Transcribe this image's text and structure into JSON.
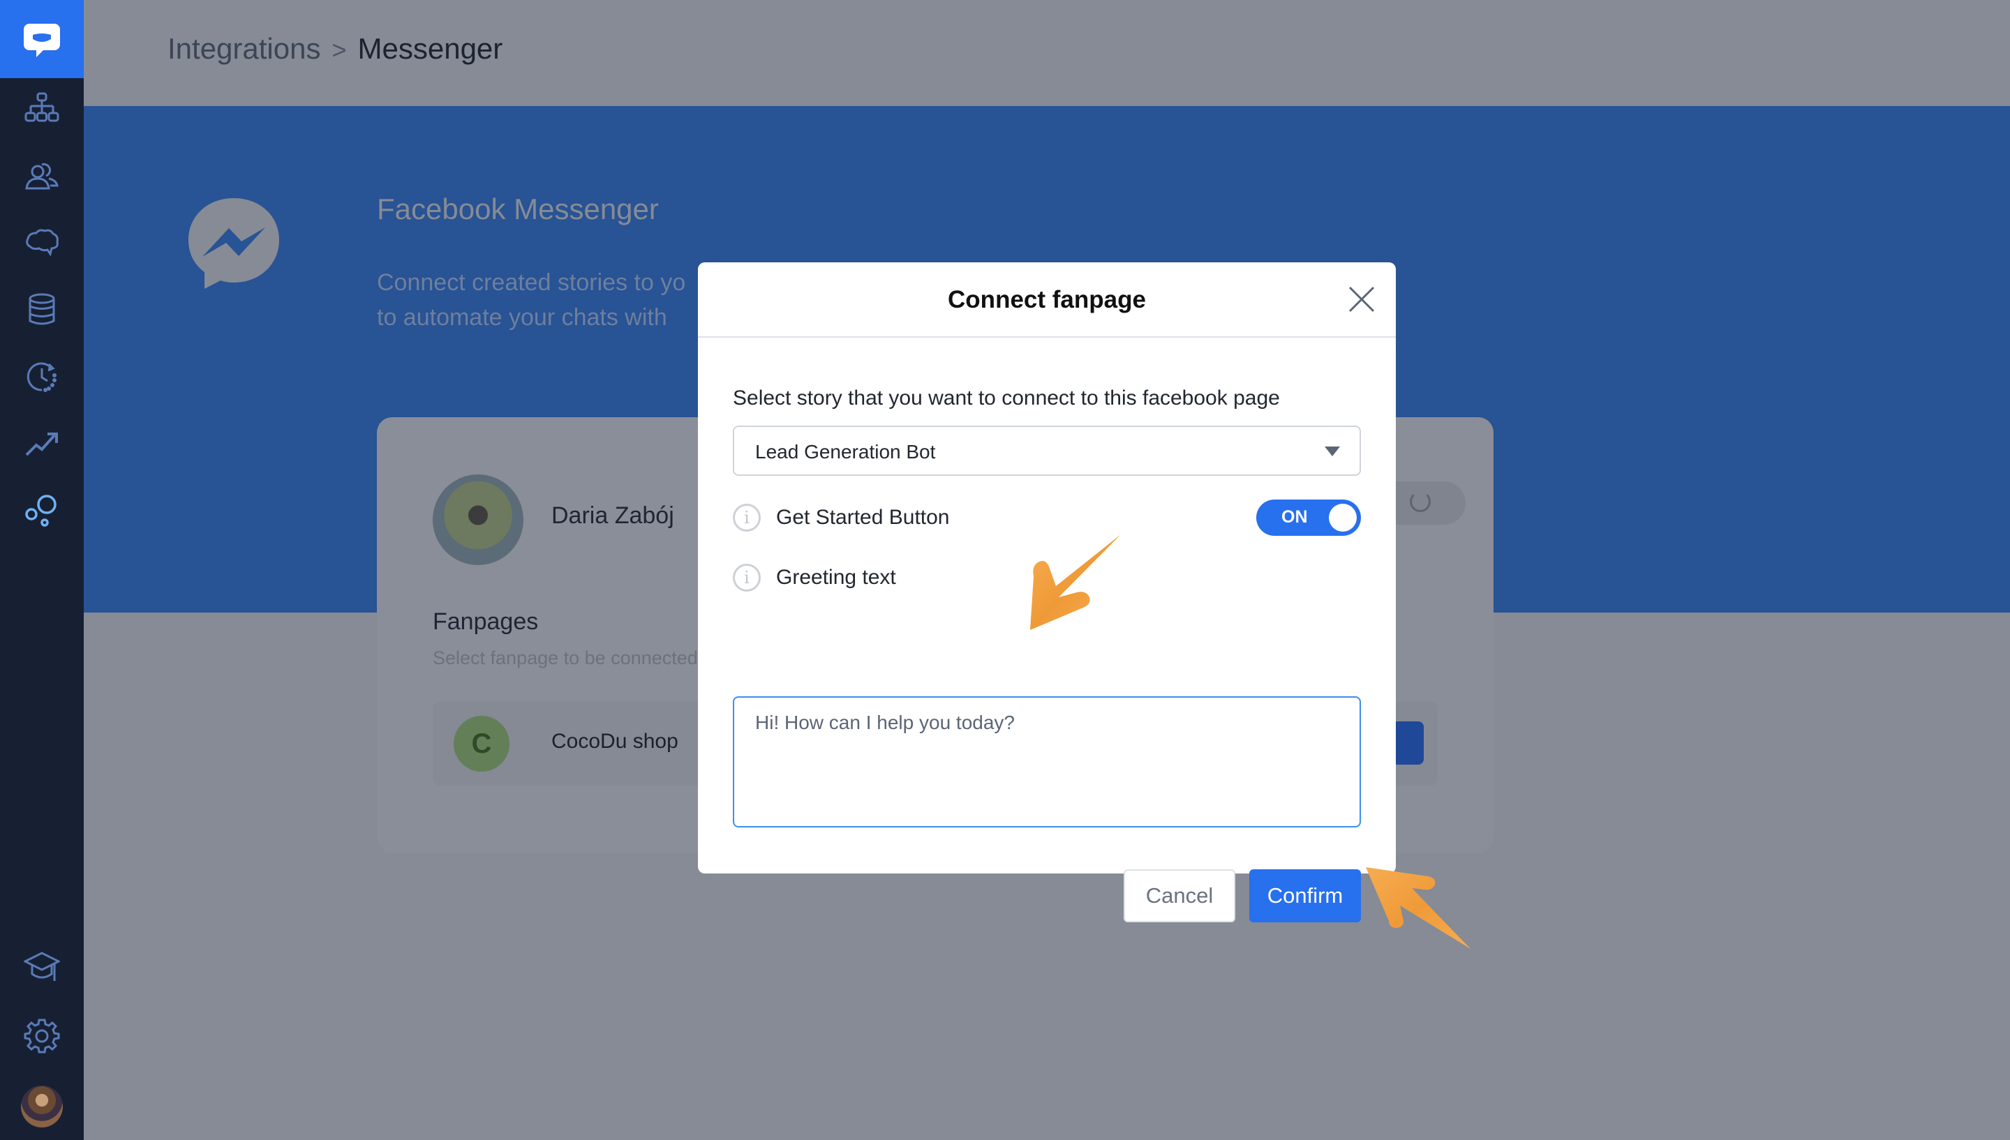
{
  "app": {
    "logo_icon": "chatbot-logo-icon",
    "accent_color": "#2770ee"
  },
  "sidebar": {
    "items": [
      {
        "name": "stories",
        "icon": "hierarchy-icon",
        "active": false
      },
      {
        "name": "users",
        "icon": "users-icon",
        "active": false
      },
      {
        "name": "training",
        "icon": "brain-icon",
        "active": false
      },
      {
        "name": "data",
        "icon": "database-icon",
        "active": false
      },
      {
        "name": "history",
        "icon": "clock-history-icon",
        "active": false
      },
      {
        "name": "reports",
        "icon": "trending-icon",
        "active": false
      },
      {
        "name": "integrations",
        "icon": "bubbles-icon",
        "active": true
      }
    ],
    "bottom_items": [
      {
        "name": "academy",
        "icon": "graduation-cap-icon"
      },
      {
        "name": "settings",
        "icon": "gear-icon"
      },
      {
        "name": "profile",
        "icon": "avatar"
      }
    ]
  },
  "header": {
    "breadcrumb": [
      "Integrations",
      "Messenger"
    ],
    "separator": ">"
  },
  "banner": {
    "title": "Facebook Messenger",
    "description_line1": "Connect created stories to yo",
    "description_line2": "to automate your chats with"
  },
  "card": {
    "account_name": "Daria Zabój",
    "fanpages_title": "Fanpages",
    "fanpages_subtitle": "Select fanpage to be connected",
    "fanpages": [
      {
        "initial": "C",
        "name": "CocoDu shop"
      }
    ]
  },
  "modal": {
    "title": "Connect fanpage",
    "select_label": "Select story that you want to connect to this facebook page",
    "select_value": "Lead Generation Bot",
    "get_started_label": "Get Started Button",
    "get_started_toggle": "ON",
    "greeting_label": "Greeting text",
    "greeting_value": "Hi! How can I help you today?",
    "cancel_label": "Cancel",
    "confirm_label": "Confirm"
  },
  "annotations": {
    "arrow_color": "#f4a142"
  }
}
